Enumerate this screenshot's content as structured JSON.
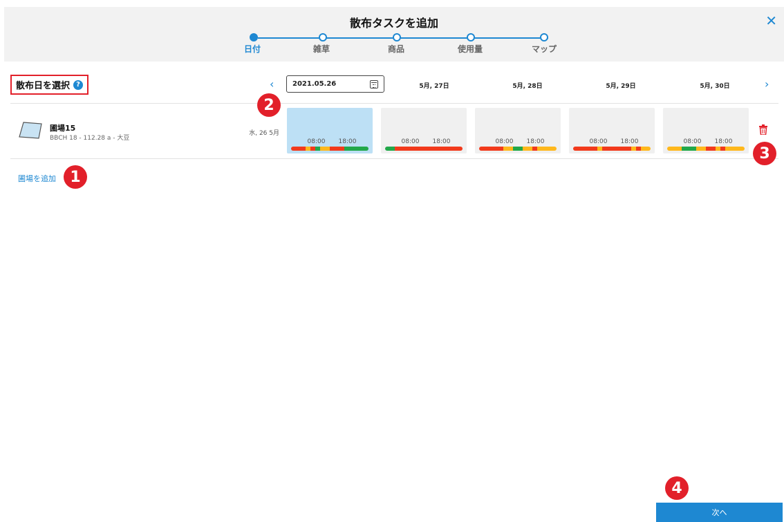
{
  "header": {
    "title": "散布タスクを追加",
    "close_icon": "✕"
  },
  "stepper": {
    "steps": [
      {
        "label": "日付",
        "active": true
      },
      {
        "label": "雑草",
        "active": false
      },
      {
        "label": "商品",
        "active": false
      },
      {
        "label": "使用量",
        "active": false
      },
      {
        "label": "マップ",
        "active": false
      }
    ]
  },
  "section": {
    "title": "散布日を選択",
    "help_icon": "?"
  },
  "date_nav": {
    "prev": "‹",
    "next": "›",
    "selected_date": "2021.05.26",
    "days": [
      "5月, 27日",
      "5月, 28日",
      "5月, 29日",
      "5月, 30日"
    ]
  },
  "field": {
    "name": "圃場15",
    "details": "BBCH 18 - 112.28 a - 大豆",
    "row_date": "水, 26 5月",
    "cells": [
      {
        "start": "08:00",
        "end": "18:00",
        "selected": true,
        "timeline": [
          [
            "#f23a1c",
            3
          ],
          [
            "#ffb81c",
            1
          ],
          [
            "#f23a1c",
            1
          ],
          [
            "#22a84a",
            1
          ],
          [
            "#ffb81c",
            2
          ],
          [
            "#f23a1c",
            3
          ],
          [
            "#22a84a",
            5
          ]
        ]
      },
      {
        "start": "08:00",
        "end": "18:00",
        "selected": false,
        "timeline": [
          [
            "#22a84a",
            2
          ],
          [
            "#f23a1c",
            14
          ]
        ]
      },
      {
        "start": "08:00",
        "end": "18:00",
        "selected": false,
        "timeline": [
          [
            "#f23a1c",
            5
          ],
          [
            "#ffb81c",
            2
          ],
          [
            "#22a84a",
            2
          ],
          [
            "#ffb81c",
            2
          ],
          [
            "#f23a1c",
            1
          ],
          [
            "#ffb81c",
            4
          ]
        ]
      },
      {
        "start": "08:00",
        "end": "18:00",
        "selected": false,
        "timeline": [
          [
            "#f23a1c",
            5
          ],
          [
            "#ffb81c",
            1
          ],
          [
            "#f23a1c",
            6
          ],
          [
            "#ffb81c",
            1
          ],
          [
            "#f23a1c",
            1
          ],
          [
            "#ffb81c",
            2
          ]
        ]
      },
      {
        "start": "08:00",
        "end": "18:00",
        "selected": false,
        "timeline": [
          [
            "#ffb81c",
            3
          ],
          [
            "#22a84a",
            3
          ],
          [
            "#ffb81c",
            2
          ],
          [
            "#f23a1c",
            2
          ],
          [
            "#ffb81c",
            1
          ],
          [
            "#f23a1c",
            1
          ],
          [
            "#ffb81c",
            4
          ]
        ]
      }
    ]
  },
  "add_field": "圃場を追加",
  "badges": [
    "1",
    "2",
    "3",
    "4"
  ],
  "next_button": "次へ",
  "colors": {
    "accent": "#1e88d2",
    "marker": "#e2202a",
    "selected_cell": "#bde0f5"
  }
}
